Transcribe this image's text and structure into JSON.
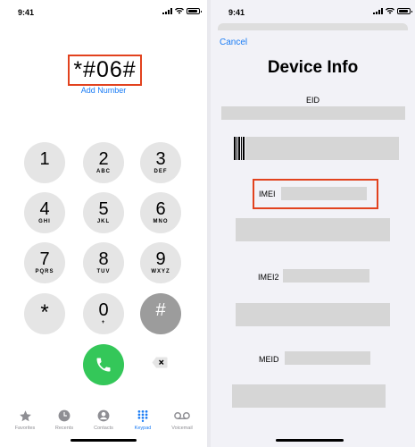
{
  "left_screen": {
    "status": {
      "time": "9:41"
    },
    "dialed_number": "*#06#",
    "add_number_label": "Add Number",
    "keypad": [
      {
        "digit": "1",
        "letters": ""
      },
      {
        "digit": "2",
        "letters": "ABC"
      },
      {
        "digit": "3",
        "letters": "DEF"
      },
      {
        "digit": "4",
        "letters": "GHI"
      },
      {
        "digit": "5",
        "letters": "JKL"
      },
      {
        "digit": "6",
        "letters": "MNO"
      },
      {
        "digit": "7",
        "letters": "PQRS"
      },
      {
        "digit": "8",
        "letters": "TUV"
      },
      {
        "digit": "9",
        "letters": "WXYZ"
      },
      {
        "digit": "*",
        "letters": ""
      },
      {
        "digit": "0",
        "letters": "+"
      },
      {
        "digit": "#",
        "letters": ""
      }
    ],
    "call_button_icon": "phone-icon",
    "backspace_icon": "delete-backward-icon",
    "tabs": [
      {
        "label": "Favorites",
        "icon": "star-icon",
        "active": false
      },
      {
        "label": "Recents",
        "icon": "clock-icon",
        "active": false
      },
      {
        "label": "Contacts",
        "icon": "person-circle-icon",
        "active": false
      },
      {
        "label": "Keypad",
        "icon": "keypad-icon",
        "active": true
      },
      {
        "label": "Voicemail",
        "icon": "voicemail-icon",
        "active": false
      }
    ]
  },
  "right_screen": {
    "status": {
      "time": "9:41"
    },
    "cancel_label": "Cancel",
    "title": "Device Info",
    "eid_label": "EID",
    "imei_label": "IMEI",
    "imei2_label": "IMEI2",
    "meid_label": "MEID"
  },
  "colors": {
    "accent_blue": "#1a7cf5",
    "call_green": "#34c759",
    "highlight_red": "#e2421e",
    "key_gray": "#e5e5e5",
    "redacted_gray": "#d6d6d6"
  }
}
